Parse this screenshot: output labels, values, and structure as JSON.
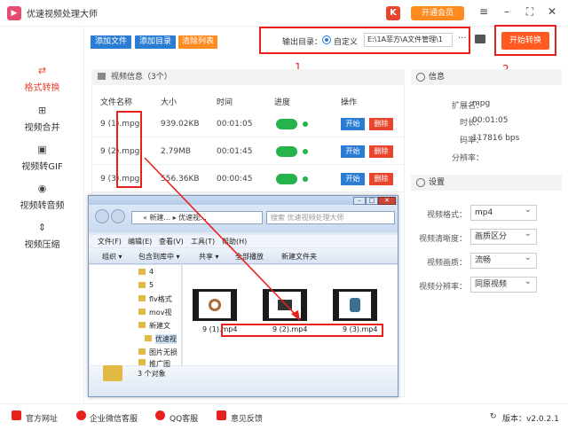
{
  "app": {
    "title": "优速视频处理大师",
    "vip_label": "开通会员"
  },
  "sidebar": {
    "items": [
      {
        "label": "格式转换",
        "icon": "convert-icon",
        "active": true
      },
      {
        "label": "视频合并",
        "icon": "merge-icon"
      },
      {
        "label": "视频转GIF",
        "icon": "gif-icon"
      },
      {
        "label": "视频转音频",
        "icon": "audio-icon"
      },
      {
        "label": "视频压缩",
        "icon": "compress-icon"
      }
    ]
  },
  "toolbar": {
    "add_file": "添加文件",
    "add_dir": "添加目录",
    "clear_list": "清除列表",
    "output_label": "输出目录：",
    "custom_label": "自定义",
    "output_path": "E:\\1A菲方\\A文件管理\\1",
    "start_label": "开始转换"
  },
  "annotations": {
    "n1": "1",
    "n2": "2"
  },
  "video_info": {
    "title": "视频信息（3个）",
    "columns": [
      "文件名称",
      "大小",
      "时间",
      "进度",
      "操作"
    ],
    "rows": [
      {
        "name": "9 (1).mpg",
        "size": "939.02KB",
        "time": "00:01:05",
        "start": "开始",
        "del": "删除"
      },
      {
        "name": "9 (2).mpg",
        "size": "2.79MB",
        "time": "00:01:45",
        "start": "开始",
        "del": "删除"
      },
      {
        "name": "9 (3).mpg",
        "size": "556.36KB",
        "time": "00:00:45",
        "start": "开始",
        "del": "删除"
      }
    ]
  },
  "info": {
    "title": "信息",
    "ext_label": "扩展名：",
    "ext": "mpg",
    "dur_label": "时长：",
    "dur": "00:01:05",
    "bitrate_label": "码率：",
    "bitrate": "117816 bps",
    "res_label": "分辨率：",
    "res": ""
  },
  "settings": {
    "title": "设置",
    "fmt_label": "视频格式：",
    "fmt": "mp4",
    "clarity_label": "视频清晰度：",
    "clarity": "画质区分",
    "quality_label": "视频画质：",
    "quality": "流畅",
    "resolution_label": "视频分辨率：",
    "resolution": "同原视频"
  },
  "footer": {
    "site": "官方网址",
    "wechat": "企业微信客服",
    "qq": "QQ客服",
    "feedback": "意见反馈",
    "version": "版本：v2.0.2.1"
  },
  "explorer": {
    "address": "« 新建... ▸ 优速视...",
    "search": "搜索 优速视频处理大师",
    "menu": [
      "文件(F)",
      "编辑(E)",
      "查看(V)",
      "工具(T)",
      "帮助(H)"
    ],
    "commands": [
      "组织 ▾",
      "包含到库中 ▾",
      "共享 ▾",
      "全部播放",
      "新建文件夹"
    ],
    "tree": [
      "4",
      "5",
      "flv格式",
      "mov视",
      "新建文",
      "优速视",
      "图片无损",
      "推广图"
    ],
    "files": [
      "9 (1).mp4",
      "9 (2).mp4",
      "9 (3).mp4"
    ],
    "status": "3 个对象"
  },
  "colors": {
    "accent": "#e8452c",
    "blue": "#2b7cd3",
    "orange": "#ff8a1f",
    "green": "#27b34c",
    "red_highlight": "#e8211c"
  }
}
